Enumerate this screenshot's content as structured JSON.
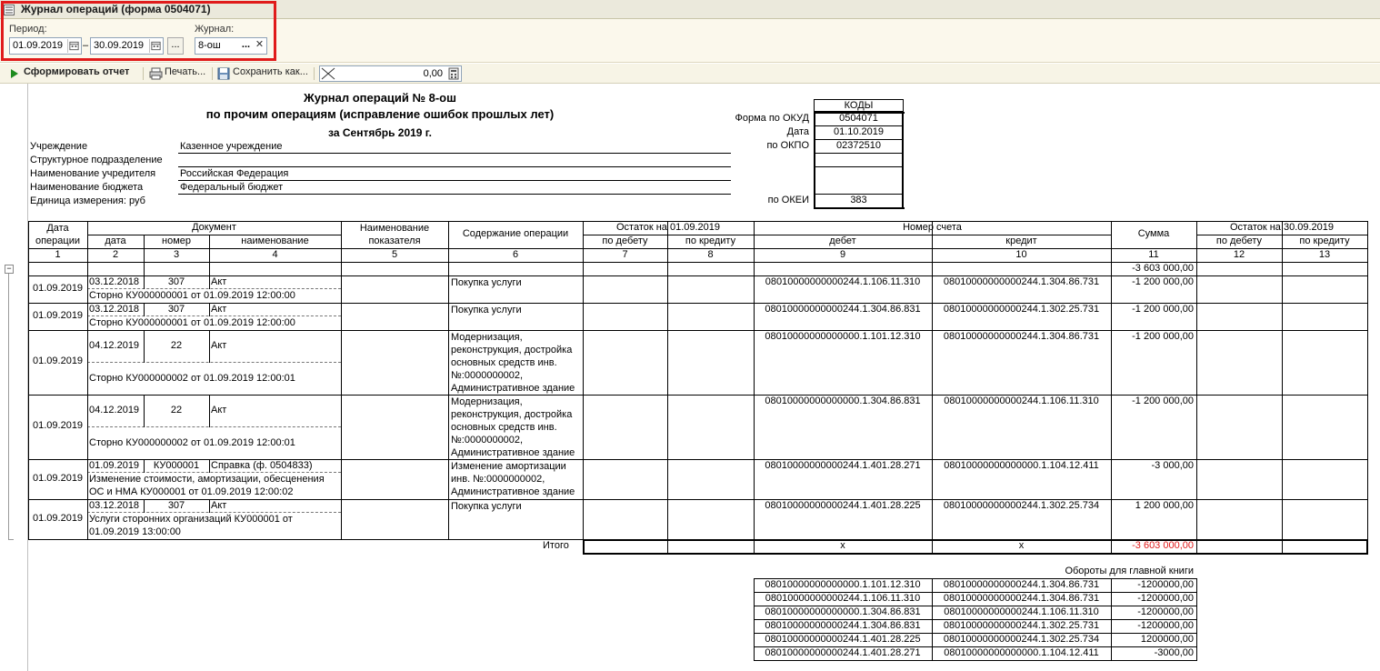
{
  "window": {
    "title": "Журнал операций (форма 0504071)"
  },
  "params": {
    "period_label": "Период:",
    "period_from": "01.09.2019",
    "period_to": "30.09.2019",
    "period_dash": "–",
    "more_btn": "...",
    "journal_label": "Журнал:",
    "journal_value": "8-ош",
    "journal_select_btn": "...",
    "journal_clear_btn": "✕"
  },
  "toolbar": {
    "build_report": "Сформировать отчет",
    "print": "Печать...",
    "save_as": "Сохранить как...",
    "number_value": "0,00"
  },
  "report": {
    "title_line1": "Журнал операций № 8-ош",
    "title_line2": "по прочим операциям (исправление ошибок прошлых лет)",
    "period_line": "за Сентябрь 2019 г.",
    "info": [
      {
        "label": "Учреждение",
        "value": "Казенное учреждение"
      },
      {
        "label": "Структурное подразделение",
        "value": ""
      },
      {
        "label": "Наименование учредителя",
        "value": "Российская Федерация"
      },
      {
        "label": "Наименование бюджета",
        "value": "Федеральный бюджет"
      },
      {
        "label": "Единица измерения: руб",
        "value": ""
      }
    ],
    "codes": {
      "header": "КОДЫ",
      "rows": [
        {
          "label": "Форма по ОКУД",
          "value": "0504071"
        },
        {
          "label": "Дата",
          "value": "01.10.2019"
        },
        {
          "label": "по ОКПО",
          "value": "02372510"
        },
        {
          "label": "",
          "value": ""
        },
        {
          "label": "",
          "value": ""
        },
        {
          "label": "по ОКЕИ",
          "value": "383"
        }
      ]
    },
    "table": {
      "h_date": "Дата операции",
      "h_document": "Документ",
      "h_doc_date": "дата",
      "h_doc_number": "номер",
      "h_doc_name": "наименование",
      "h_indicator": "Наименование показателя",
      "h_content": "Содержание операции",
      "h_balance_start": "Остаток на 01.09.2019",
      "h_debit_side": "по дебету",
      "h_credit_side": "по кредиту",
      "h_account": "Номер счета",
      "h_debit": "дебет",
      "h_credit": "кредит",
      "h_sum": "Сумма",
      "h_balance_end": "Остаток на 30.09.2019",
      "h_debit_side2": "по дебету",
      "h_credit_side2": "по кредиту",
      "col_numbers": [
        "1",
        "2",
        "3",
        "4",
        "5",
        "6",
        "7",
        "8",
        "9",
        "10",
        "11",
        "12",
        "13"
      ],
      "opening_sum": "-3 603 000,00",
      "rows": [
        {
          "date": "01.09.2019",
          "doc_date": "03.12.2018",
          "doc_number": "307",
          "doc_name": "Акт",
          "storno": "Сторно КУ000000001 от 01.09.2019 12:00:00",
          "content": "Покупка услуги",
          "debit": "08010000000000244.1.106.11.310",
          "credit": "08010000000000244.1.304.86.731",
          "sum": "-1 200 000,00"
        },
        {
          "date": "01.09.2019",
          "doc_date": "03.12.2018",
          "doc_number": "307",
          "doc_name": "Акт",
          "storno": "Сторно КУ000000001 от 01.09.2019 12:00:00",
          "content": "Покупка услуги",
          "debit": "08010000000000244.1.304.86.831",
          "credit": "08010000000000244.1.302.25.731",
          "sum": "-1 200 000,00"
        },
        {
          "date": "01.09.2019",
          "doc_date": "04.12.2019",
          "doc_number": "22",
          "doc_name": "Акт",
          "storno": "Сторно КУ000000002 от 01.09.2019 12:00:01",
          "content": "Модернизация, реконструкция, достройка основных средств инв. №:0000000002, Административное здание",
          "debit": "08010000000000000.1.101.12.310",
          "credit": "08010000000000244.1.304.86.731",
          "sum": "-1 200 000,00"
        },
        {
          "date": "01.09.2019",
          "doc_date": "04.12.2019",
          "doc_number": "22",
          "doc_name": "Акт",
          "storno": "Сторно КУ000000002 от 01.09.2019 12:00:01",
          "content": "Модернизация, реконструкция, достройка основных средств инв. №:0000000002, Административное здание",
          "debit": "08010000000000000.1.304.86.831",
          "credit": "08010000000000244.1.106.11.310",
          "sum": "-1 200 000,00"
        },
        {
          "date": "01.09.2019",
          "doc_date": "01.09.2019",
          "doc_number": "КУ000001",
          "doc_name": "Справка (ф. 0504833)",
          "storno": "Изменение стоимости, амортизации, обесценения ОС и НМА КУ000001 от 01.09.2019 12:00:02",
          "content": "Изменение амортизации инв. №:0000000002, Административное здание",
          "debit": "08010000000000244.1.401.28.271",
          "credit": "08010000000000000.1.104.12.411",
          "sum": "-3 000,00"
        },
        {
          "date": "01.09.2019",
          "doc_date": "03.12.2018",
          "doc_number": "307",
          "doc_name": "Акт",
          "storno": "Услуги сторонних организаций КУ000001 от 01.09.2019 13:00:00",
          "content": "Покупка услуги",
          "debit": "08010000000000244.1.401.28.225",
          "credit": "08010000000000244.1.302.25.734",
          "sum": "1 200 000,00"
        }
      ],
      "total_label": "Итого",
      "total_debit": "х",
      "total_credit": "х",
      "total_sum": "-3 603 000,00"
    },
    "ledger": {
      "title": "Обороты для главной книги",
      "rows": [
        {
          "debit": "08010000000000000.1.101.12.310",
          "credit": "08010000000000244.1.304.86.731",
          "sum": "-1200000,00"
        },
        {
          "debit": "08010000000000244.1.106.11.310",
          "credit": "08010000000000244.1.304.86.731",
          "sum": "-1200000,00"
        },
        {
          "debit": "08010000000000000.1.304.86.831",
          "credit": "08010000000000244.1.106.11.310",
          "sum": "-1200000,00"
        },
        {
          "debit": "08010000000000244.1.304.86.831",
          "credit": "08010000000000244.1.302.25.731",
          "sum": "-1200000,00"
        },
        {
          "debit": "08010000000000244.1.401.28.225",
          "credit": "08010000000000244.1.302.25.734",
          "sum": "1200000,00"
        },
        {
          "debit": "08010000000000244.1.401.28.271",
          "credit": "08010000000000000.1.104.12.411",
          "sum": "-3000,00"
        }
      ]
    }
  },
  "colors": {
    "highlight": "#e01b1b",
    "negative_total": "#e01b1b",
    "toolbar_bg": "#f7f4e6"
  }
}
